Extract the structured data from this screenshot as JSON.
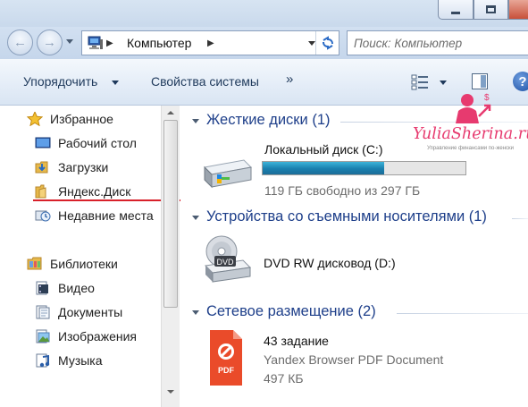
{
  "window": {
    "buttons": [
      "minimize",
      "maximize",
      "close"
    ]
  },
  "address": {
    "location": "Компьютер",
    "search_placeholder": "Поиск: Компьютер",
    "icon": "computer-icon"
  },
  "toolbar": {
    "organize_label": "Упорядочить",
    "system_properties_label": "Свойства системы",
    "more_label": "»"
  },
  "sidebar": {
    "items": [
      {
        "label": "Избранное",
        "icon": "star-icon"
      },
      {
        "label": "Рабочий стол",
        "icon": "desktop-icon"
      },
      {
        "label": "Загрузки",
        "icon": "downloads-folder-icon"
      },
      {
        "label": "Яндекс.Диск",
        "icon": "folder-icon"
      },
      {
        "label": "Недавние места",
        "icon": "recent-places-icon"
      },
      {
        "label": "Библиотеки",
        "icon": "libraries-icon"
      },
      {
        "label": "Видео",
        "icon": "video-icon"
      },
      {
        "label": "Документы",
        "icon": "documents-icon"
      },
      {
        "label": "Изображения",
        "icon": "pictures-icon"
      },
      {
        "label": "Музыка",
        "icon": "music-icon"
      }
    ]
  },
  "groups": [
    {
      "title": "Жесткие диски (1)",
      "items": [
        {
          "name": "Локальный диск (C:)",
          "detail": "119 ГБ свободно из 297 ГБ",
          "used_fraction": 0.6,
          "icon": "hard-drive-icon"
        }
      ]
    },
    {
      "title": "Устройства со съемными носителями (1)",
      "items": [
        {
          "name": "DVD RW дисковод (D:)",
          "icon": "dvd-drive-icon",
          "badge": "DVD"
        }
      ]
    },
    {
      "title": "Сетевое размещение (2)",
      "items": [
        {
          "name": "43 задание",
          "type": "Yandex Browser PDF Document",
          "size": "497 КБ",
          "icon": "pdf-icon",
          "badge": "PDF"
        }
      ]
    }
  ],
  "watermark": {
    "text": "YuliaSherina.ru",
    "tagline": "Управление финансами по-женски",
    "accent": "#e73a6f"
  },
  "colors": {
    "group_title": "#1e3f8a",
    "annotation_underline": "#d8202a",
    "capacity_bar": "#1a7fae"
  }
}
